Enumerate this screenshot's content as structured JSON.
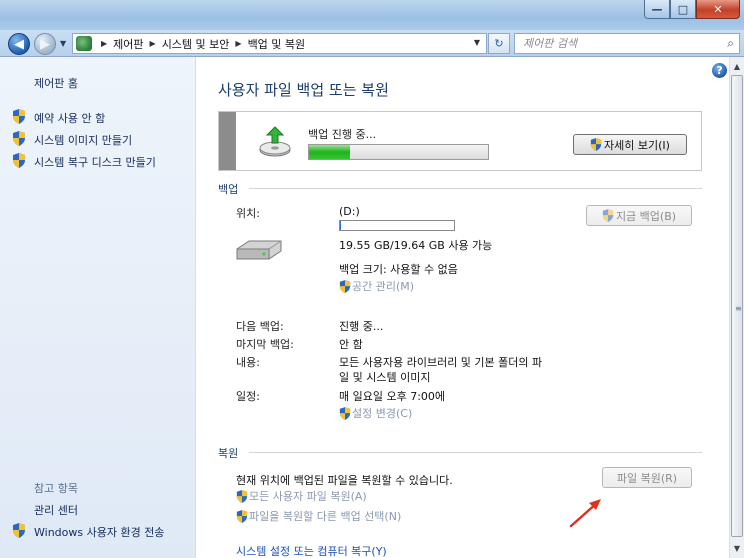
{
  "window": {
    "title_buttons": {
      "minimize": "—",
      "maximize": "□",
      "close": "✕"
    }
  },
  "nav": {
    "back_icon": "back-arrow-icon",
    "forward_icon": "forward-arrow-icon",
    "breadcrumbs": [
      "제어판",
      "시스템 및 보안",
      "백업 및 복원"
    ],
    "search_placeholder": "제어판 검색",
    "refresh_icon": "refresh-icon"
  },
  "sidebar": {
    "home": "제어판 홈",
    "links": [
      {
        "label": "예약 사용 안 함",
        "icon": "uac-shield-icon"
      },
      {
        "label": "시스템 이미지 만들기",
        "icon": "uac-shield-icon"
      },
      {
        "label": "시스템 복구 디스크 만들기",
        "icon": "uac-shield-icon"
      }
    ],
    "see_also": "참고 항목",
    "see_also_links": [
      {
        "label": "관리 센터"
      },
      {
        "label": "Windows 사용자 환경 전송",
        "icon": "uac-shield-icon"
      }
    ]
  },
  "main": {
    "title": "사용자 파일 백업 또는 복원",
    "progress": {
      "label": "백업 진행 중...",
      "fraction": 0.23,
      "details_button": "자세히 보기(I)"
    },
    "backup": {
      "header": "백업",
      "location_label": "위치:",
      "location_value": "(D:)",
      "drive_used_fraction": 0.005,
      "drive_space": "19.55 GB/19.64 GB 사용 가능",
      "backup_size": "백업 크기: 사용할 수 없음",
      "manage_space": "공간 관리(M)",
      "backup_now_button": "지금 백업(B)",
      "rows": [
        {
          "label": "다음 백업:",
          "value": "진행 중..."
        },
        {
          "label": "마지막 백업:",
          "value": "안 함"
        },
        {
          "label": "내용:",
          "value_line1": "모든 사용자용 라이브러리 및 기본 폴더의 파",
          "value_line2": "일 및 시스템 이미지"
        },
        {
          "label": "일정:",
          "value": "매 일요일 오후 7:00에"
        }
      ],
      "change_settings": "설정 변경(C)"
    },
    "restore": {
      "header": "복원",
      "description": "현재 위치에 백업된 파일을 복원할 수 있습니다.",
      "restore_files_button": "파일 복원(R)",
      "restore_all_users": "모든 사용자 파일 복원(A)",
      "select_other_backup": "파일을 복원할 다른 백업 선택(N)",
      "recover_system": "시스템 설정 또는 컴퓨터 복구(Y)"
    }
  },
  "colors": {
    "title_blue": "#1b3e6e",
    "link_blue": "#1a50b8",
    "progress_green": "#1fb41c",
    "annotation_red": "#e0301e"
  }
}
